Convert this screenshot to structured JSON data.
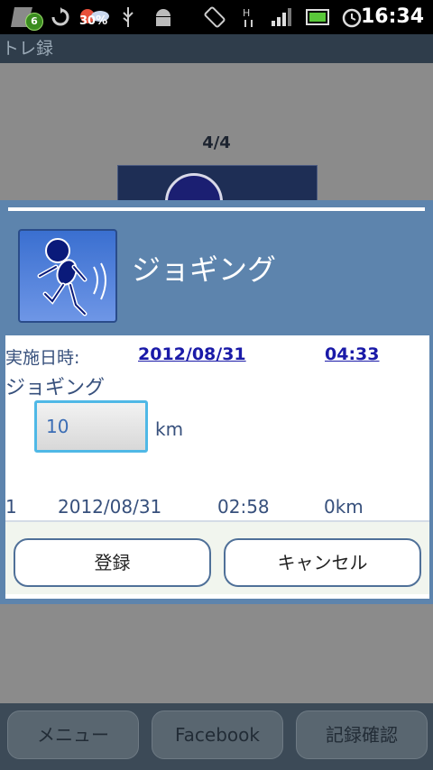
{
  "status_bar": {
    "notification_count": "6",
    "battery_weather_pct": "30%",
    "time": "16:34",
    "icons": [
      "notification-icon",
      "sync-icon",
      "weather-icon",
      "usb-icon",
      "android-debug-icon",
      "rotation-icon",
      "hspa-icon",
      "signal-icon",
      "battery-icon",
      "alarm-icon"
    ]
  },
  "app_title": "トレ録",
  "background": {
    "pager": "4/4"
  },
  "dialog": {
    "title": "ジョギング",
    "date_label": "実施日時:",
    "date_value": "2012/08/31",
    "time_value": "04:33",
    "exercise_name": "ジョギング",
    "distance_value": "10",
    "distance_unit": "km",
    "history": {
      "index": "1",
      "date": "2012/08/31",
      "time": "02:58",
      "distance": "0km"
    },
    "register_label": "登録",
    "cancel_label": "キャンセル"
  },
  "bottom_nav": {
    "menu": "メニュー",
    "facebook": "Facebook",
    "records": "記録確認"
  },
  "colors": {
    "dialog_bg": "#5d84ad",
    "accent": "#4fb8e6",
    "link": "#1a1aa8"
  }
}
